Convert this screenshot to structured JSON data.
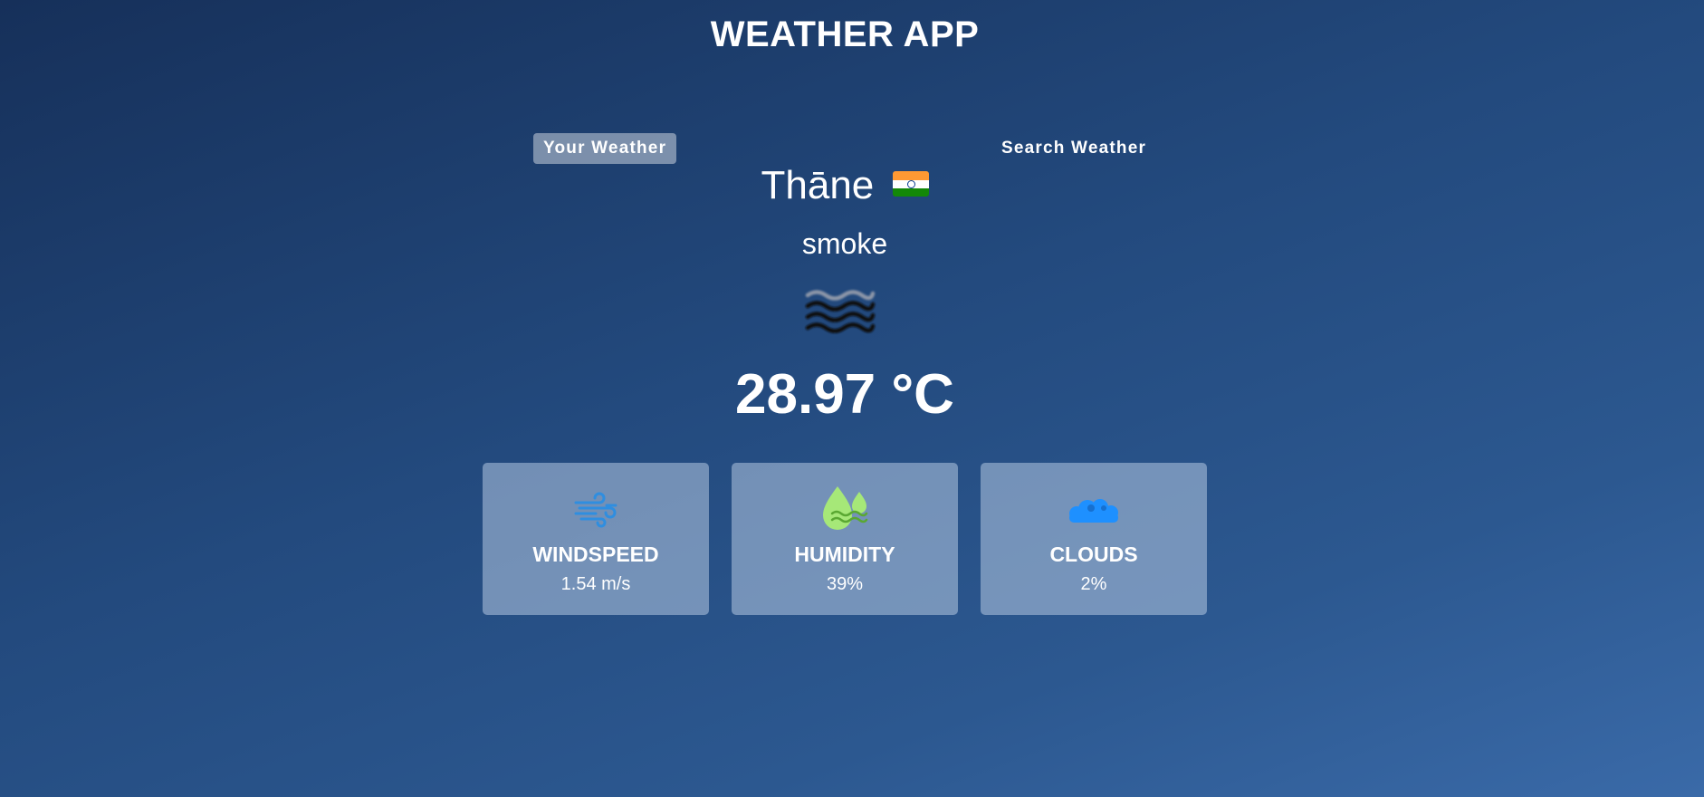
{
  "app": {
    "title": "WEATHER APP"
  },
  "tabs": {
    "your_weather": "Your Weather",
    "search_weather": "Search Weather",
    "active": "your_weather"
  },
  "location": {
    "city": "Thāne",
    "country_flag_icon": "india-flag-icon"
  },
  "weather": {
    "description": "smoke",
    "icon": "smoke-haze-icon",
    "temperature": "28.97 °C"
  },
  "stats": {
    "windspeed": {
      "label": "WINDSPEED",
      "value": "1.54 m/s",
      "icon": "wind-icon"
    },
    "humidity": {
      "label": "HUMIDITY",
      "value": "39%",
      "icon": "humidity-drops-icon"
    },
    "clouds": {
      "label": "CLOUDS",
      "value": "2%",
      "icon": "cloud-icon"
    }
  },
  "colors": {
    "background_top": "#16305a",
    "background_bottom": "#3a6aa8",
    "card_background": "#8aa2c2",
    "wind_icon": "#2f8ee0",
    "humidity_icon": "#a6e878",
    "cloud_icon": "#1e90ff"
  }
}
